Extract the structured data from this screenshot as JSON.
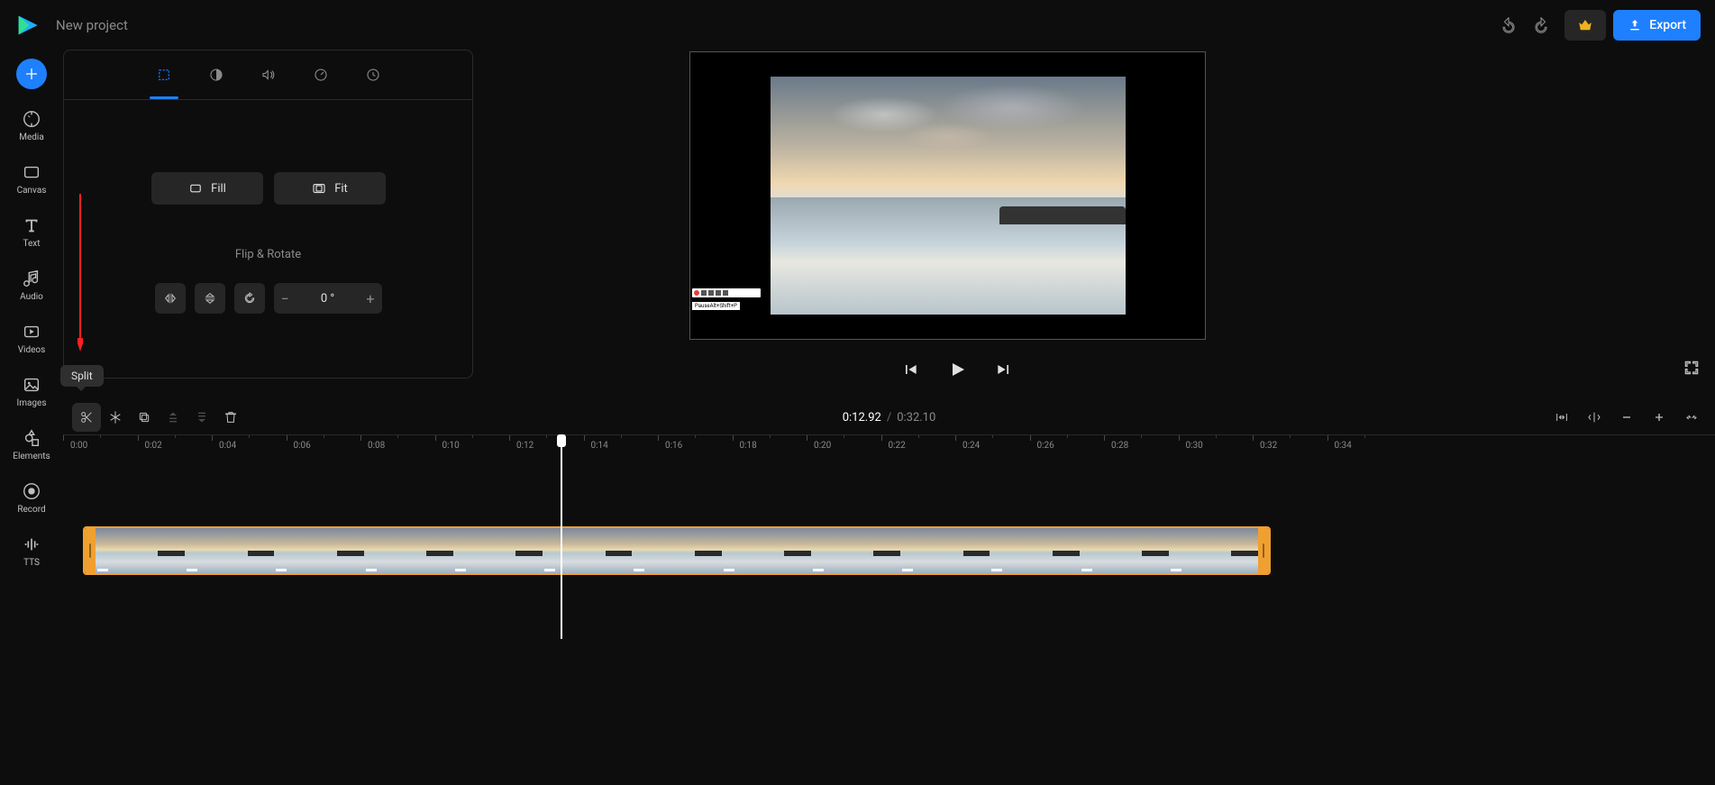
{
  "header": {
    "project_title": "New project",
    "export_label": "Export"
  },
  "sidebar": {
    "items": [
      {
        "label": "Media"
      },
      {
        "label": "Canvas"
      },
      {
        "label": "Text"
      },
      {
        "label": "Audio"
      },
      {
        "label": "Videos"
      },
      {
        "label": "Images"
      },
      {
        "label": "Elements"
      },
      {
        "label": "Record"
      },
      {
        "label": "TTS"
      }
    ]
  },
  "panel": {
    "fill_label": "Fill",
    "fit_label": "Fit",
    "flip_rotate_title": "Flip & Rotate",
    "angle_value": "0 °"
  },
  "tooltip": {
    "split": "Split"
  },
  "mini_label": "PauseAlt+Shift+P",
  "playback": {
    "current_time": "0:12.92",
    "separator": "/",
    "total_time": "0:32.10"
  },
  "ruler": {
    "ticks": [
      "0:00",
      "0:02",
      "0:04",
      "0:06",
      "0:08",
      "0:10",
      "0:12",
      "0:14",
      "0:16",
      "0:18",
      "0:20",
      "0:22",
      "0:24",
      "0:26",
      "0:28",
      "0:30",
      "0:32",
      "0:34"
    ]
  }
}
